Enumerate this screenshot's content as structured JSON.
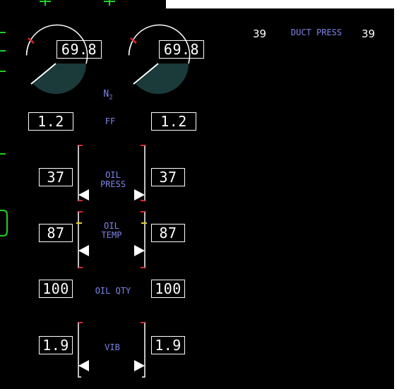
{
  "colors": {
    "background": "#000000",
    "frame_outside": "#ffffff",
    "value_text": "#ffffff",
    "label_text": "#7d84e6",
    "limit_marker_red": "#e0242b",
    "caution_marker_amber": "#e6d21e",
    "pointer_white": "#ffffff",
    "gauge_fill": "#1b3a3a",
    "overlay_scale_green": "#1ed11e"
  },
  "duct_press": {
    "label": "DUCT PRESS",
    "left_value": "39",
    "right_value": "39"
  },
  "n2": {
    "label": "N",
    "label_sub": "2",
    "left_value": "69.8",
    "right_value": "69.8"
  },
  "ff": {
    "label": "FF",
    "left_value": "1.2",
    "right_value": "1.2"
  },
  "oil_press": {
    "label_line1": "OIL",
    "label_line2": "PRESS",
    "left_value": "37",
    "right_value": "37"
  },
  "oil_temp": {
    "label_line1": "OIL",
    "label_line2": "TEMP",
    "left_value": "87",
    "right_value": "87"
  },
  "oil_qty": {
    "label": "OIL QTY",
    "left_value": "100",
    "right_value": "100"
  },
  "vib": {
    "label": "VIB",
    "left_value": "1.9",
    "right_value": "1.9"
  }
}
